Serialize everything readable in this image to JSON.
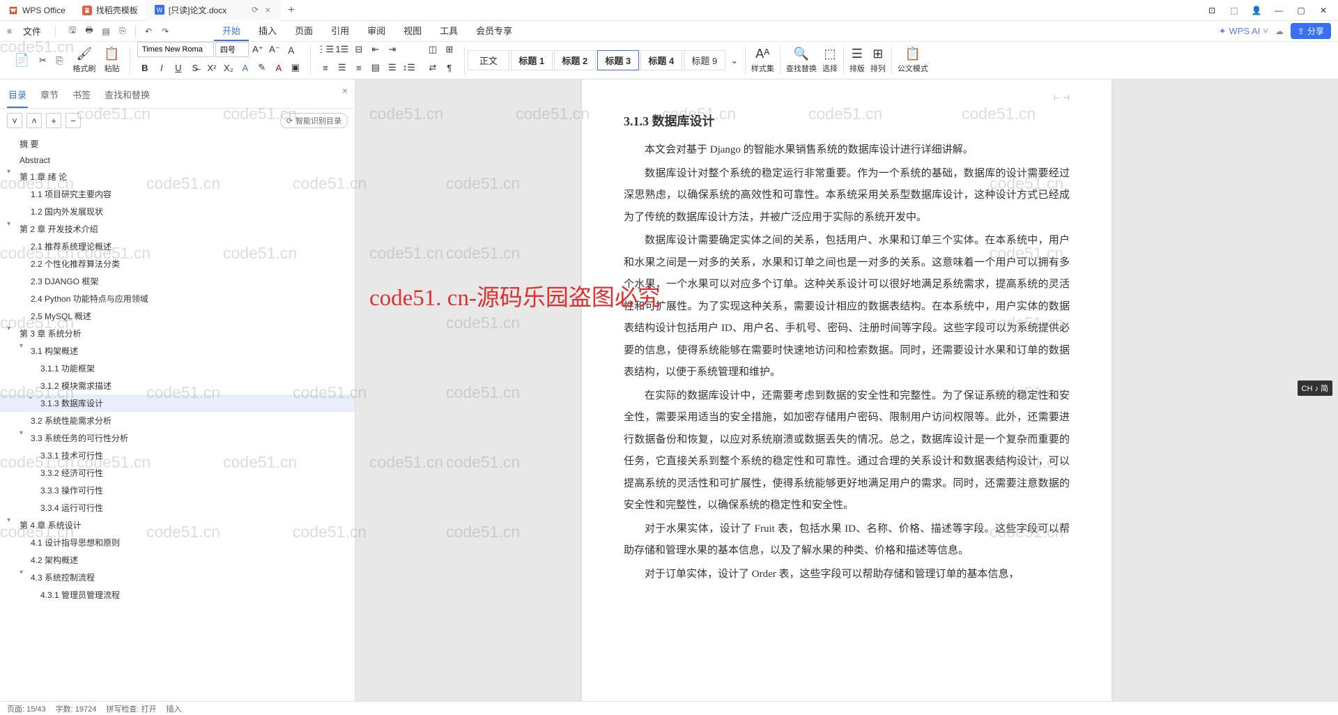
{
  "tabs": {
    "t0": "WPS Office",
    "t1": "找稻壳模板",
    "t2": "[只读]论文.docx"
  },
  "menu": {
    "file": "文件",
    "items": [
      "开始",
      "插入",
      "页面",
      "引用",
      "审阅",
      "视图",
      "工具",
      "会员专享"
    ],
    "wps_ai": "WPS AI",
    "share": "分享"
  },
  "ribbon": {
    "format_painter": "格式刷",
    "paste": "粘贴",
    "font_name": "Times New Roma",
    "font_size": "四号",
    "styles": [
      "正文",
      "标题 1",
      "标题 2",
      "标题 3",
      "标题 4",
      "标题 9"
    ],
    "selected_style": 3,
    "style_set": "样式集",
    "find_replace": "查找替换",
    "select": "选择",
    "sort": "排版",
    "arrange": "排列",
    "official": "公文模式"
  },
  "nav": {
    "tabs": [
      "目录",
      "章节",
      "书签",
      "查找和替换"
    ],
    "smart": "智能识别目录",
    "toc": {
      "abstract_zh": "摘 要",
      "abstract_en": "Abstract",
      "c1": "第 1 章  绪  论",
      "c1_1": "1.1 项目研究主要内容",
      "c1_2": "1.2 国内外发展现状",
      "c2": "第 2 章  开发技术介绍",
      "c2_1": "2.1 推荐系统理论概述",
      "c2_2": "2.2 个性化推荐算法分类",
      "c2_3": "2.3 DJANGO 框架",
      "c2_4": "2.4 Python 功能特点与应用领域",
      "c2_5": "2.5 MySQL 概述",
      "c3": "第 3 章  系统分析",
      "c3_1": "3.1 构架概述",
      "c3_1_1": "3.1.1 功能框架",
      "c3_1_2": "3.1.2 模块需求描述",
      "c3_1_3": "3.1.3 数据库设计",
      "c3_2": "3.2 系统性能需求分析",
      "c3_3": "3.3 系统任务的可行性分析",
      "c3_3_1": "3.3.1 技术可行性",
      "c3_3_2": "3.3.2 经济可行性",
      "c3_3_3": "3.3.3 操作可行性",
      "c3_3_4": "3.3.4 运行可行性",
      "c4": "第 4 章  系统设计",
      "c4_1": "4.1 设计指导思想和原则",
      "c4_2": "4.2 架构概述",
      "c4_3": "4.3 系统控制流程",
      "c4_3_1": "4.3.1 管理员管理流程"
    }
  },
  "doc": {
    "heading": "3.1.3 数据库设计",
    "p1": "本文会对基于 Django 的智能水果销售系统的数据库设计进行详细讲解。",
    "p2": "数据库设计对整个系统的稳定运行非常重要。作为一个系统的基础，数据库的设计需要经过深思熟虑，以确保系统的高效性和可靠性。本系统采用关系型数据库设计，这种设计方式已经成为了传统的数据库设计方法，并被广泛应用于实际的系统开发中。",
    "p3": "数据库设计需要确定实体之间的关系，包括用户、水果和订单三个实体。在本系统中，用户和水果之间是一对多的关系，水果和订单之间也是一对多的关系。这意味着一个用户可以拥有多个水果，一个水果可以对应多个订单。这种关系设计可以很好地满足系统需求，提高系统的灵活性和可扩展性。为了实现这种关系，需要设计相应的数据表结构。在本系统中，用户实体的数据表结构设计包括用户 ID、用户名、手机号、密码、注册时间等字段。这些字段可以为系统提供必要的信息，使得系统能够在需要时快速地访问和检索数据。同时，还需要设计水果和订单的数据表结构，以便于系统管理和维护。",
    "p4": "在实际的数据库设计中，还需要考虑到数据的安全性和完整性。为了保证系统的稳定性和安全性，需要采用适当的安全措施，如加密存储用户密码、限制用户访问权限等。此外，还需要进行数据备份和恢复，以应对系统崩溃或数据丢失的情况。总之，数据库设计是一个复杂而重要的任务，它直接关系到整个系统的稳定性和可靠性。通过合理的关系设计和数据表结构设计，可以提高系统的灵活性和可扩展性，使得系统能够更好地满足用户的需求。同时，还需要注意数据的安全性和完整性，以确保系统的稳定性和安全性。",
    "p5": "对于水果实体，设计了 Fruit 表，包括水果 ID、名称、价格、描述等字段。这些字段可以帮助存储和管理水果的基本信息，以及了解水果的种类、价格和描述等信息。",
    "p6": "对于订单实体，设计了 Order 表，这些字段可以帮助存储和管理订单的基本信息，"
  },
  "status": {
    "page": "页面: 15/43",
    "words": "字数: 19724",
    "spell": "拼写检查: 打开",
    "mode": "插入"
  },
  "watermark": "code51.cn",
  "center_wm": "code51. cn-源码乐园盗图必究",
  "ime": "CH ♪ 简"
}
